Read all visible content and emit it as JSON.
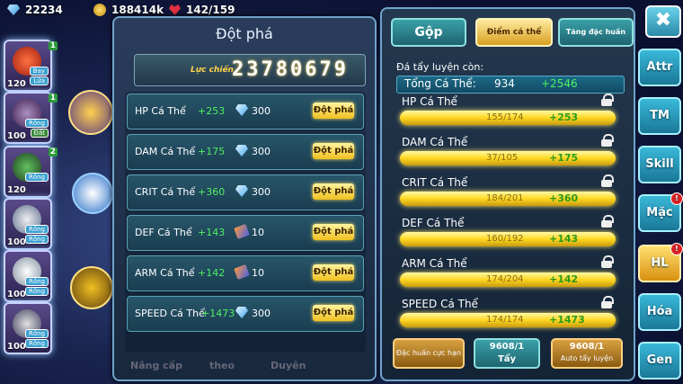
{
  "topbar": {
    "diamonds": "22234",
    "gold": "188414k",
    "stamina": "142/159"
  },
  "team": [
    {
      "level": "120",
      "tags": [
        "Bay",
        "Lửa"
      ],
      "badge": "1"
    },
    {
      "level": "100",
      "tags": [
        "Rồng",
        "Đất"
      ],
      "badge": "1"
    },
    {
      "level": "120",
      "tags": [
        "Rồng"
      ],
      "badge": "2"
    },
    {
      "level": "100",
      "tags": [
        "Rồng",
        "Rồng"
      ],
      "badge": ""
    },
    {
      "level": "100",
      "tags": [
        "Rồng",
        "Rồng"
      ],
      "badge": ""
    },
    {
      "level": "100",
      "tags": [
        "Rồng",
        "Rồng"
      ],
      "badge": ""
    }
  ],
  "breakthrough": {
    "title": "Đột phá",
    "power_label": "Lực chiến",
    "power_value": "23780679",
    "button_label": "Đột phá",
    "rows": [
      {
        "label": "HP Cá Thể",
        "bonus": "+253",
        "cost_icon": "diamond-icon",
        "cost": "300"
      },
      {
        "label": "DAM Cá Thể",
        "bonus": "+175",
        "cost_icon": "diamond-icon",
        "cost": "300"
      },
      {
        "label": "CRIT Cá Thể",
        "bonus": "+360",
        "cost_icon": "diamond-icon",
        "cost": "300"
      },
      {
        "label": "DEF Cá Thể",
        "bonus": "+143",
        "cost_icon": "stone-icon",
        "cost": "10"
      },
      {
        "label": "ARM Cá Thể",
        "bonus": "+142",
        "cost_icon": "stone-icon",
        "cost": "10"
      },
      {
        "label": "SPEED Cá Thể",
        "bonus": "+1473",
        "cost_icon": "diamond-icon",
        "cost": "300"
      }
    ],
    "footer": [
      "Nâng cấp",
      "theo",
      "Duyên"
    ]
  },
  "training": {
    "tabs": [
      "Gộp",
      "Điểm cá thể",
      "Tăng đặc huấn"
    ],
    "heading": "Đá tẩy luyện còn:",
    "total_label": "Tổng Cá Thể:",
    "total_value": "934",
    "total_bonus": "+2546",
    "stats": [
      {
        "name": "HP Cá Thể",
        "progress": "155/174",
        "plus": "+253"
      },
      {
        "name": "DAM Cá Thể",
        "progress": "37/105",
        "plus": "+175"
      },
      {
        "name": "CRIT Cá Thể",
        "progress": "184/201",
        "plus": "+360"
      },
      {
        "name": "DEF Cá Thể",
        "progress": "160/192",
        "plus": "+143"
      },
      {
        "name": "ARM Cá Thể",
        "progress": "174/204",
        "plus": "+142"
      },
      {
        "name": "SPEED Cá Thể",
        "progress": "174/174",
        "plus": "+1473"
      }
    ],
    "buttons": {
      "special": "Đặc huấn cực hạn",
      "wash_count": "9608/1",
      "wash_label": "Tẩy",
      "auto_count": "9608/1",
      "auto_label": "Auto tẩy luyện"
    }
  },
  "side_menu": [
    "Attr",
    "TM",
    "Skill",
    "Mặc",
    "HL",
    "Hóa",
    "Gen"
  ],
  "side_badges": {
    "mac": "!",
    "hl": "!"
  },
  "close_symbol": "✖"
}
